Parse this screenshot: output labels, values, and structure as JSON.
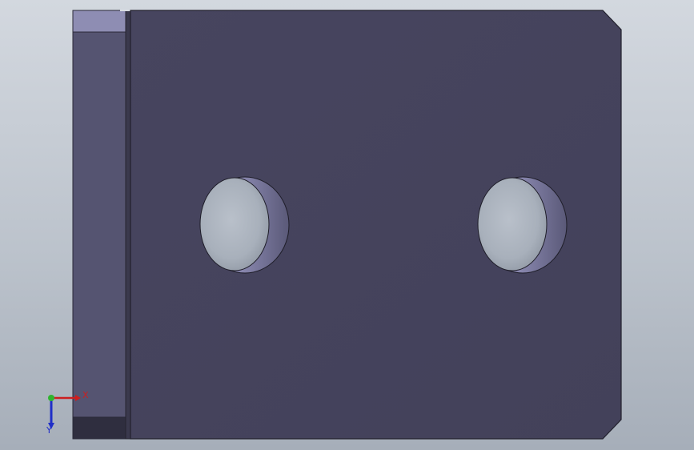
{
  "viewport": {
    "background_top": "#d3d8df",
    "background_bottom": "#a6aeb9"
  },
  "model": {
    "face_color": "#45435c",
    "side_face_color": "#555471",
    "side_cap_color": "#8e8db3",
    "side_bottom_color": "#2f2e3f",
    "hole_count": 2
  },
  "triad": {
    "x_label": "X",
    "y_label": "Y",
    "x_color": "#cc1f1f",
    "y_color": "#1f2ec8",
    "origin_color": "#2fb42f"
  }
}
